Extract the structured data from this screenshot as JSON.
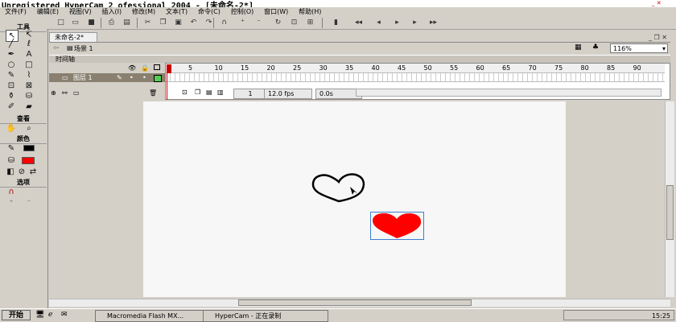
{
  "window": {
    "title": "Unregistered HyperCam 2 ofessional 2004 - [未命名-2*]",
    "controls": "_ ✕"
  },
  "menu": [
    "文件(F)",
    "编辑(E)",
    "视图(V)",
    "插入(I)",
    "修改(M)",
    "文本(T)",
    "命令(C)",
    "控制(O)",
    "窗口(W)",
    "帮助(H)"
  ],
  "tools_panel": {
    "section_tools": "工具",
    "section_view": "查看",
    "section_colors": "颜色",
    "section_options": "选项"
  },
  "document": {
    "tab_label": "未命名-2*",
    "scene_label": "场景 1",
    "zoom_value": "116%",
    "timeline_label": "时间轴",
    "layer_name": "图层 1",
    "frame_ticks": [
      "1",
      "5",
      "10",
      "15",
      "20",
      "25",
      "30",
      "35",
      "40",
      "45",
      "50",
      "55",
      "60",
      "65",
      "70",
      "75",
      "80",
      "85",
      "90"
    ],
    "current_frame": "1",
    "frame_rate": "12.0 fps",
    "elapsed": "0.0s"
  },
  "colors": {
    "heart_fill": "#ff0000",
    "stage": "#f7f7f7",
    "layer_row": "#8a8070"
  },
  "taskbar": {
    "start": "开始",
    "task1": "Macromedia Flash MX...",
    "task2": "HyperCam - 正在录制",
    "clock": "15:25"
  }
}
